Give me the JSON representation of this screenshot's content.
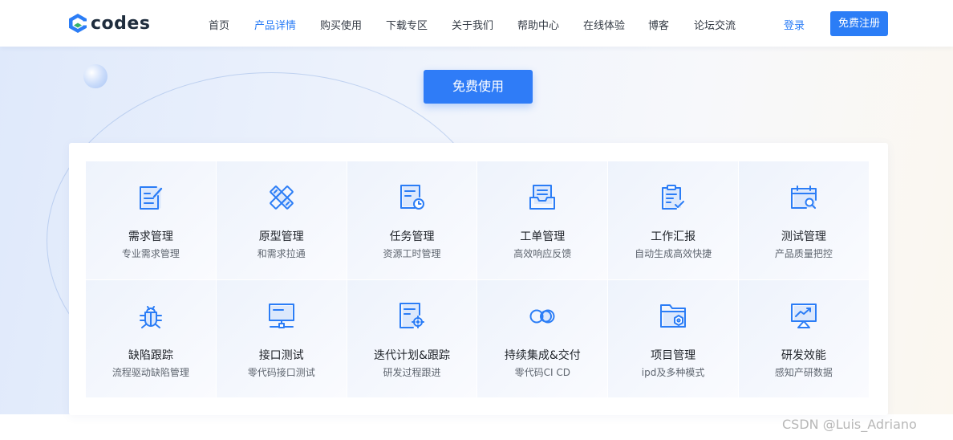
{
  "brand": {
    "logo_text": "codes",
    "logo_icon": "codes-logo-icon",
    "accent": "#2b7df6"
  },
  "nav": {
    "items": [
      {
        "label": "首页",
        "active": false
      },
      {
        "label": "产品详情",
        "active": true
      },
      {
        "label": "购买使用",
        "active": false
      },
      {
        "label": "下载专区",
        "active": false
      },
      {
        "label": "关于我们",
        "active": false
      },
      {
        "label": "帮助中心",
        "active": false
      },
      {
        "label": "在线体验",
        "active": false
      },
      {
        "label": "博客",
        "active": false
      },
      {
        "label": "论坛交流",
        "active": false
      }
    ],
    "login_label": "登录",
    "register_label": "免费注册"
  },
  "hero": {
    "cta_label": "免费使用"
  },
  "features": [
    {
      "title": "需求管理",
      "subtitle": "专业需求管理",
      "icon": "requirement-icon"
    },
    {
      "title": "原型管理",
      "subtitle": "和需求拉通",
      "icon": "prototype-icon"
    },
    {
      "title": "任务管理",
      "subtitle": "资源工时管理",
      "icon": "task-clock-icon"
    },
    {
      "title": "工单管理",
      "subtitle": "高效响应反馈",
      "icon": "ticket-tray-icon"
    },
    {
      "title": "工作汇报",
      "subtitle": "自动生成高效快捷",
      "icon": "report-clipboard-icon"
    },
    {
      "title": "测试管理",
      "subtitle": "产品质量把控",
      "icon": "test-calendar-search-icon"
    },
    {
      "title": "缺陷跟踪",
      "subtitle": "流程驱动缺陷管理",
      "icon": "bug-icon"
    },
    {
      "title": "接口测试",
      "subtitle": "零代码接口测试",
      "icon": "api-monitor-icon"
    },
    {
      "title": "迭代计划&跟踪",
      "subtitle": "研发过程跟进",
      "icon": "iteration-target-icon"
    },
    {
      "title": "持续集成&交付",
      "subtitle": "零代码CI CD",
      "icon": "ci-cd-rings-icon"
    },
    {
      "title": "项目管理",
      "subtitle": "ipd及多种模式",
      "icon": "project-folder-icon"
    },
    {
      "title": "研发效能",
      "subtitle": "感知产研数据",
      "icon": "efficiency-chart-icon"
    }
  ],
  "watermark": "CSDN @Luis_Adriano"
}
